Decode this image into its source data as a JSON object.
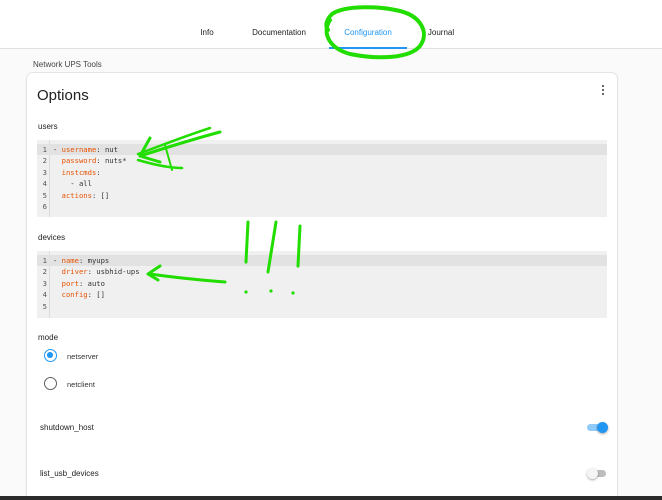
{
  "tabs": [
    {
      "label": "Info"
    },
    {
      "label": "Documentation"
    },
    {
      "label": "Configuration"
    },
    {
      "label": "Journal"
    }
  ],
  "addon_name": "Network UPS Tools",
  "options": {
    "title": "Options",
    "users": {
      "label": "users",
      "lines": [
        {
          "n": "1",
          "key": "username",
          "val": "nut",
          "prefix": "- "
        },
        {
          "n": "2",
          "key": "password",
          "val": "nuts*",
          "prefix": "  "
        },
        {
          "n": "3",
          "key": "instcmds",
          "val": "",
          "prefix": "  "
        },
        {
          "n": "4",
          "text": "    - all"
        },
        {
          "n": "5",
          "key": "actions",
          "val": "[]",
          "prefix": "  "
        },
        {
          "n": "6",
          "text": ""
        }
      ]
    },
    "devices": {
      "label": "devices",
      "lines": [
        {
          "n": "1",
          "key": "name",
          "val": "myups",
          "prefix": "- "
        },
        {
          "n": "2",
          "key": "driver",
          "val": "usbhid-ups",
          "prefix": "  "
        },
        {
          "n": "3",
          "key": "port",
          "val": "auto",
          "prefix": "  "
        },
        {
          "n": "4",
          "key": "config",
          "val": "[]",
          "prefix": "  "
        },
        {
          "n": "5",
          "text": ""
        }
      ]
    },
    "mode": {
      "label": "mode",
      "options": [
        "netserver",
        "netclient"
      ],
      "selected": "netserver"
    },
    "shutdown_host": {
      "label": "shutdown_host",
      "enabled": true
    },
    "list_usb_devices": {
      "label": "list_usb_devices",
      "enabled": false
    }
  },
  "colors": {
    "accent": "#2196f3",
    "yaml_key": "#e65100",
    "annotation": "#22dd00"
  }
}
